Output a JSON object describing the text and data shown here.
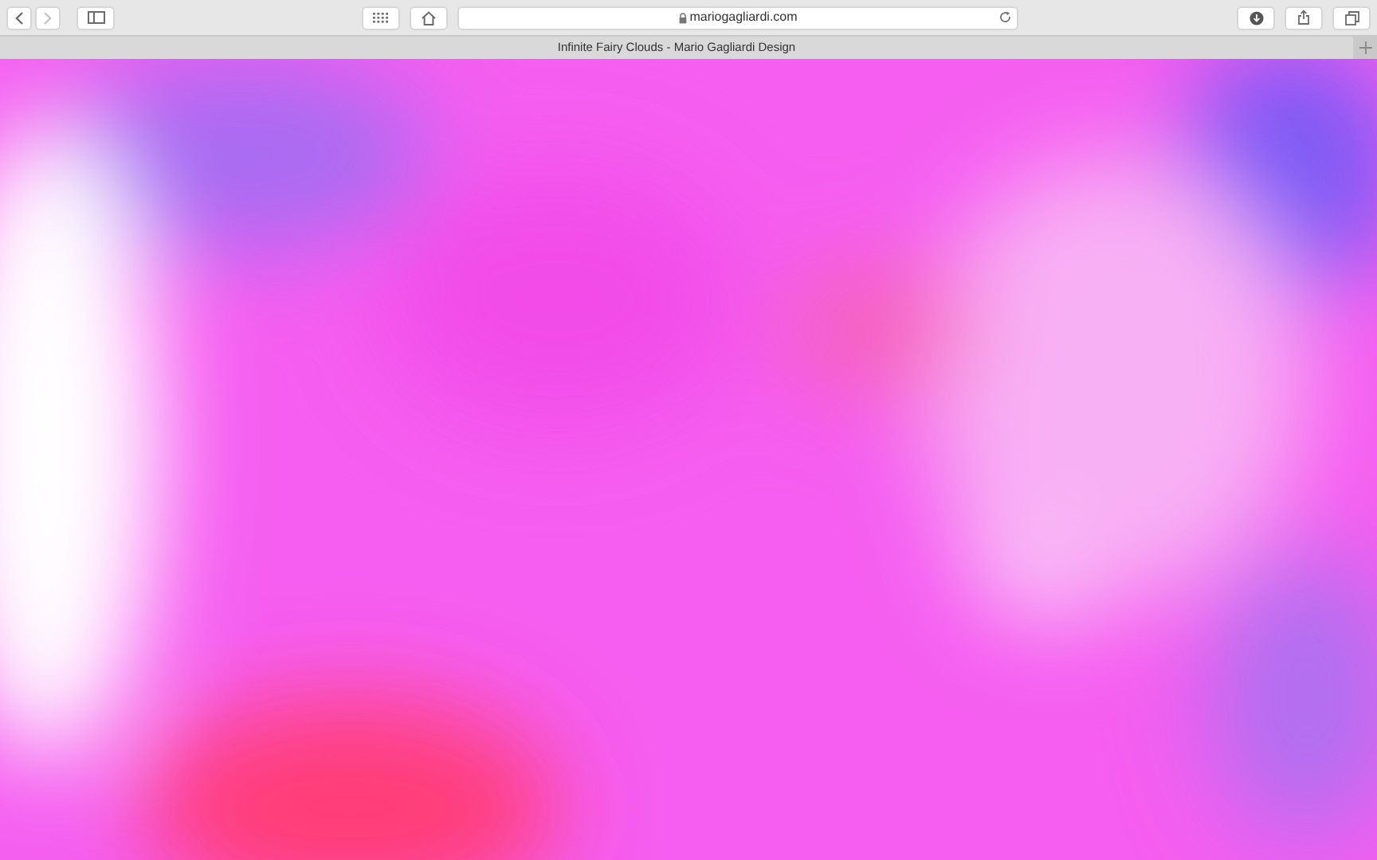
{
  "toolbar": {
    "back": {
      "disabled": false
    },
    "forward": {
      "disabled": true
    },
    "address": "mariogagliardi.com"
  },
  "tabs": [
    {
      "label": "Infinite Fairy Clouds - Mario Gagliardi Design",
      "selected": true
    }
  ]
}
